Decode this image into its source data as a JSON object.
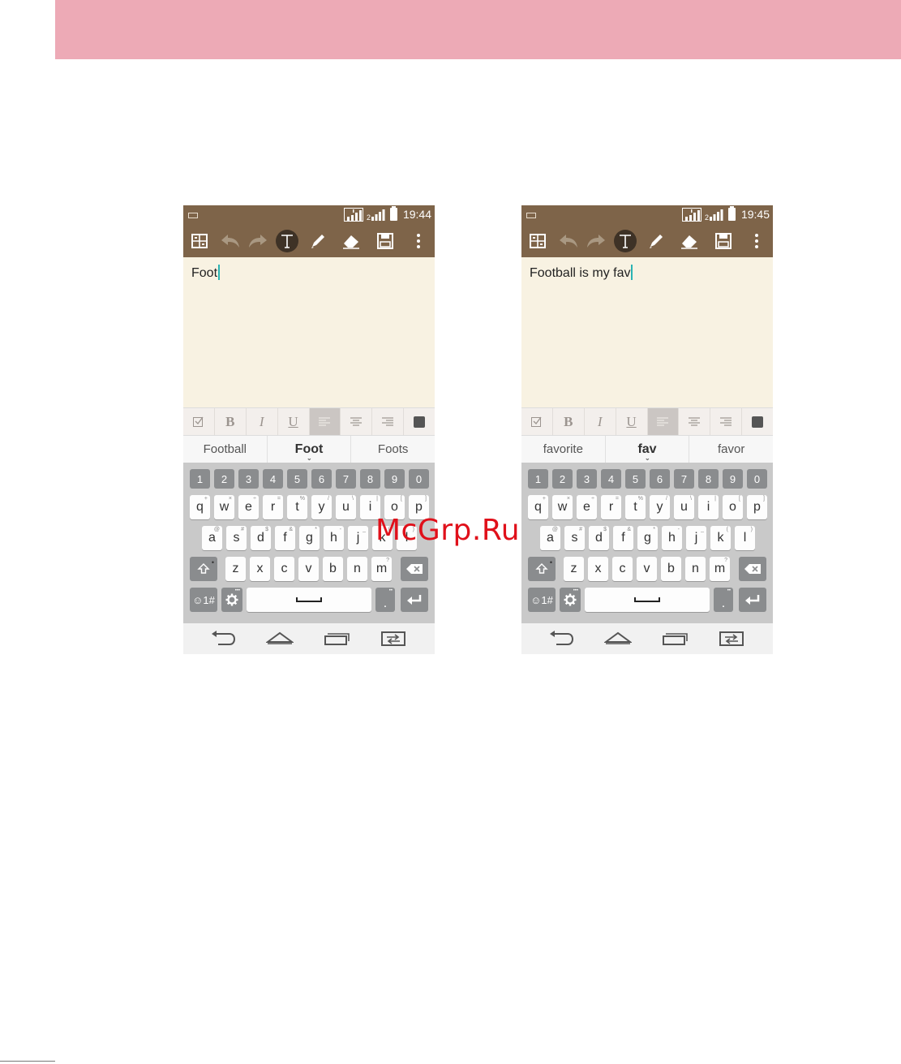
{
  "watermark": "McGrp.Ru",
  "screens": [
    {
      "time": "19:44",
      "note_text": "Foot",
      "suggestions": [
        "Football",
        "Foot",
        "Foots"
      ]
    },
    {
      "time": "19:45",
      "note_text": "Football is my fav",
      "suggestions": [
        "favorite",
        "fav",
        "favor"
      ]
    }
  ],
  "format": {
    "bold": "B",
    "italic": "I",
    "underline": "U"
  },
  "keyboard": {
    "numbers": [
      "1",
      "2",
      "3",
      "4",
      "5",
      "6",
      "7",
      "8",
      "9",
      "0"
    ],
    "row1": [
      "q",
      "w",
      "e",
      "r",
      "t",
      "y",
      "u",
      "i",
      "o",
      "p"
    ],
    "row1_alt": [
      "+",
      "×",
      "÷",
      "=",
      "%",
      "/",
      "\\",
      "|",
      "[",
      "]"
    ],
    "row2": [
      "a",
      "s",
      "d",
      "f",
      "g",
      "h",
      "j",
      "k",
      "l"
    ],
    "row2_alt": [
      "@",
      "#",
      "$",
      "&",
      "*",
      "-",
      "_",
      "(",
      ")"
    ],
    "row3": [
      "z",
      "x",
      "c",
      "v",
      "b",
      "n",
      "m"
    ],
    "row3_alt": [
      "",
      "",
      "",
      "",
      "",
      "",
      "?"
    ],
    "symbols_label": "☺1#",
    "period": "."
  },
  "colors": {
    "toolbar": "#7e6449",
    "note_bg": "#f8f2e2",
    "header_band": "#edaab6",
    "cursor": "#2ab3b3",
    "watermark": "#e0101a"
  }
}
